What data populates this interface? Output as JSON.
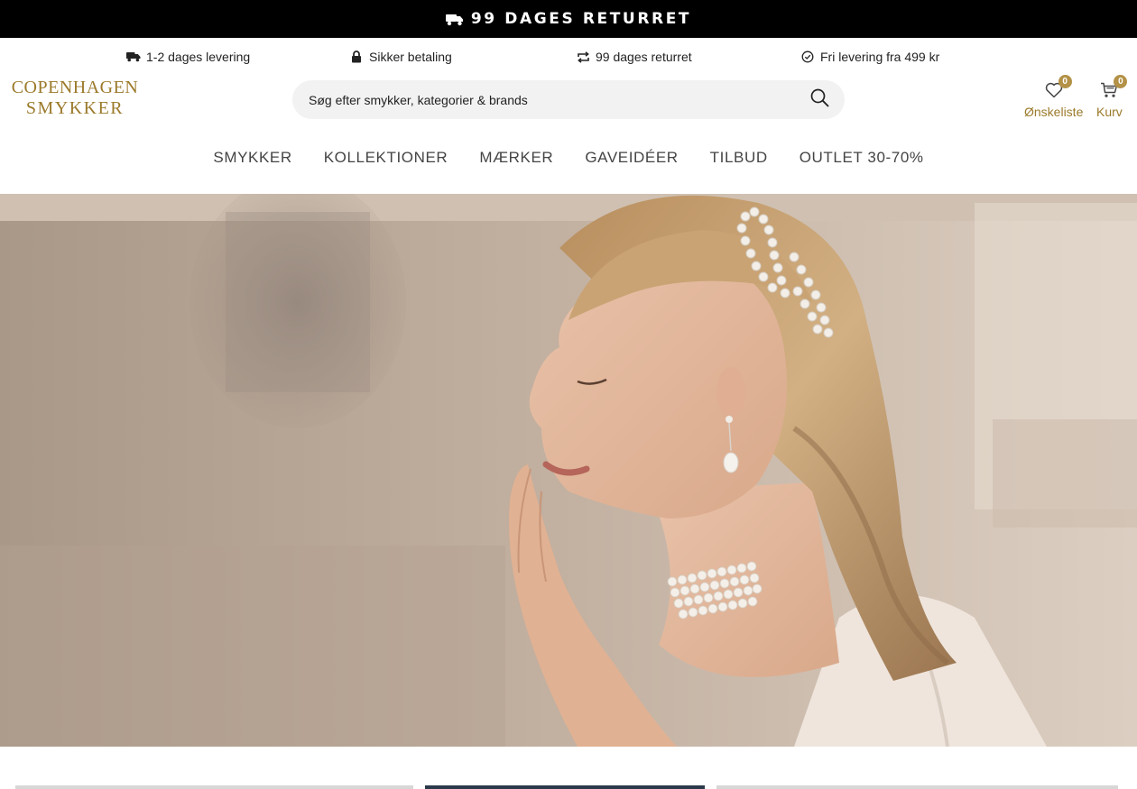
{
  "announcement": {
    "icon": "truck-icon",
    "text": "99 DAGES RETURRET"
  },
  "usps": [
    {
      "icon": "truck-icon",
      "text": "1-2 dages levering"
    },
    {
      "icon": "lock-icon",
      "text": "Sikker betaling"
    },
    {
      "icon": "return-arrows-icon",
      "text": "99 dages returret"
    },
    {
      "icon": "check-circle-icon",
      "text": "Fri levering fra 499 kr"
    }
  ],
  "logo": {
    "line1": "COPENHAGEN",
    "line2": "SMYKKER"
  },
  "search": {
    "placeholder": "Søg efter smykker, kategorier & brands"
  },
  "header_actions": {
    "wishlist": {
      "label": "Ønskeliste",
      "count": "0"
    },
    "cart": {
      "label": "Kurv",
      "count": "0"
    }
  },
  "nav": [
    "SMYKKER",
    "KOLLEKTIONER",
    "MÆRKER",
    "GAVEIDÉER",
    "TILBUD",
    "OUTLET 30-70%"
  ],
  "colors": {
    "accent_gold": "#9b7a2b",
    "badge": "#b39146",
    "announcement_bg": "#000000"
  }
}
